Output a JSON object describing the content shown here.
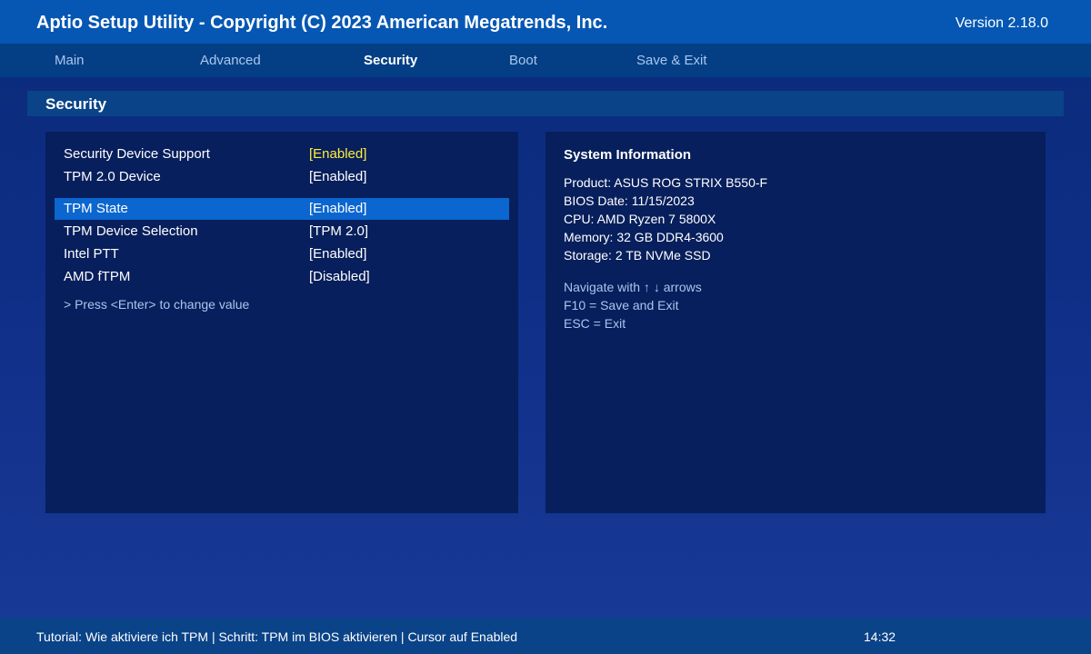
{
  "header": {
    "title": "Aptio Setup Utility - Copyright (C) 2023 American Megatrends, Inc.",
    "version": "Version 2.18.0"
  },
  "tabs": [
    {
      "label": "Main"
    },
    {
      "label": "Advanced"
    },
    {
      "label": "Security",
      "active": true
    },
    {
      "label": "Boot"
    },
    {
      "label": "Save & Exit"
    }
  ],
  "section": {
    "title": "Security"
  },
  "settings": [
    {
      "label": "Security Device Support",
      "value": "[Enabled]",
      "highlighted_value": true
    },
    {
      "label": "TPM 2.0 Device",
      "value": "[Enabled]"
    },
    {
      "label": "TPM State",
      "value": "[Enabled]",
      "selected": true
    },
    {
      "label": "TPM Device Selection",
      "value": "[TPM 2.0]"
    },
    {
      "label": "Intel PTT",
      "value": "[Enabled]"
    },
    {
      "label": "AMD fTPM",
      "value": "[Disabled]"
    }
  ],
  "hint": "> Press <Enter> to change value",
  "system_info": {
    "title": "System Information",
    "lines": [
      "Product: ASUS ROG STRIX B550-F",
      "BIOS Date: 11/15/2023",
      "CPU: AMD Ryzen 7 5800X",
      "Memory: 32 GB DDR4-3600",
      "Storage: 2 TB NVMe SSD"
    ],
    "help": [
      "Navigate with ↑ ↓ arrows",
      "F10 = Save and Exit",
      "ESC = Exit"
    ]
  },
  "status": {
    "text": "Tutorial: Wie aktiviere ich TPM | Schritt: TPM im BIOS aktivieren | Cursor auf Enabled",
    "time": "14:32"
  },
  "colors": {
    "title_bar": "#0557b3",
    "menu_bar": "#043f85",
    "panel": "#071f5c",
    "selection": "#0c66cf",
    "highlight_text": "#ffef3a",
    "muted_text": "#a9c6ef"
  }
}
